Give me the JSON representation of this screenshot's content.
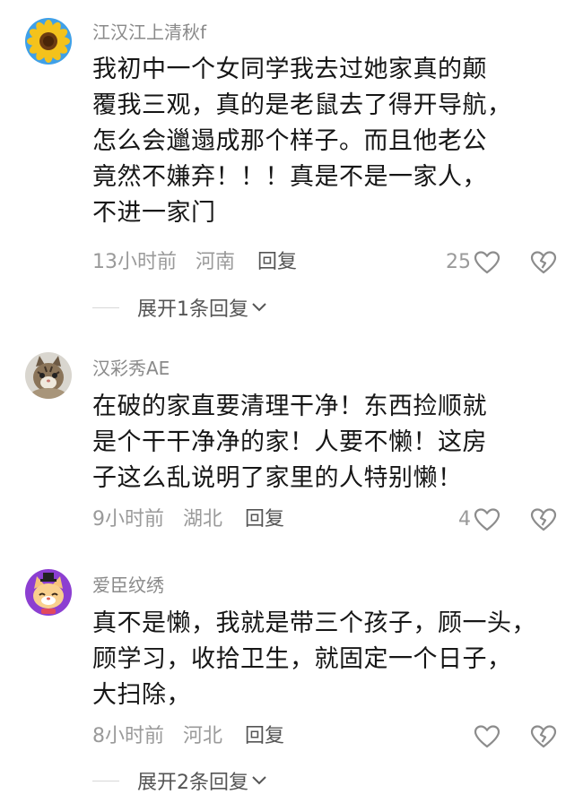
{
  "comments": [
    {
      "username": "江汉江上清秋f",
      "avatar_icon": "sunflower-avatar",
      "lines": [
        "我初中一个女同学我去过她家真的颠",
        "覆我三观，真的是老鼠去了得开导航，",
        "怎么会邋遢成那个样子。而且他老公",
        "竟然不嫌弃！！！真是不是一家人，",
        "不进一家门"
      ],
      "time": "13小时前",
      "location": "河南",
      "reply_label": "回复",
      "like_count": "25",
      "expand_label": "展开1条回复"
    },
    {
      "username": "汉彩秀AE",
      "avatar_icon": "cat-photo-avatar",
      "lines": [
        "在破的家直要清理干净！东西捡顺就",
        "是个干干净净的家！人要不懒！这房",
        "子这么乱说明了家里的人特别懒！"
      ],
      "time": "9小时前",
      "location": "湖北",
      "reply_label": "回复",
      "like_count": "4"
    },
    {
      "username": "爱臣纹绣",
      "avatar_icon": "cartoon-cat-avatar",
      "lines": [
        "真不是懒，我就是带三个孩子，顾一头，",
        "顾学习，收拾卫生，就固定一个日子，",
        "大扫除，"
      ],
      "time": "8小时前",
      "location": "河北",
      "reply_label": "回复",
      "like_count": "",
      "expand_label": "展开2条回复"
    }
  ]
}
